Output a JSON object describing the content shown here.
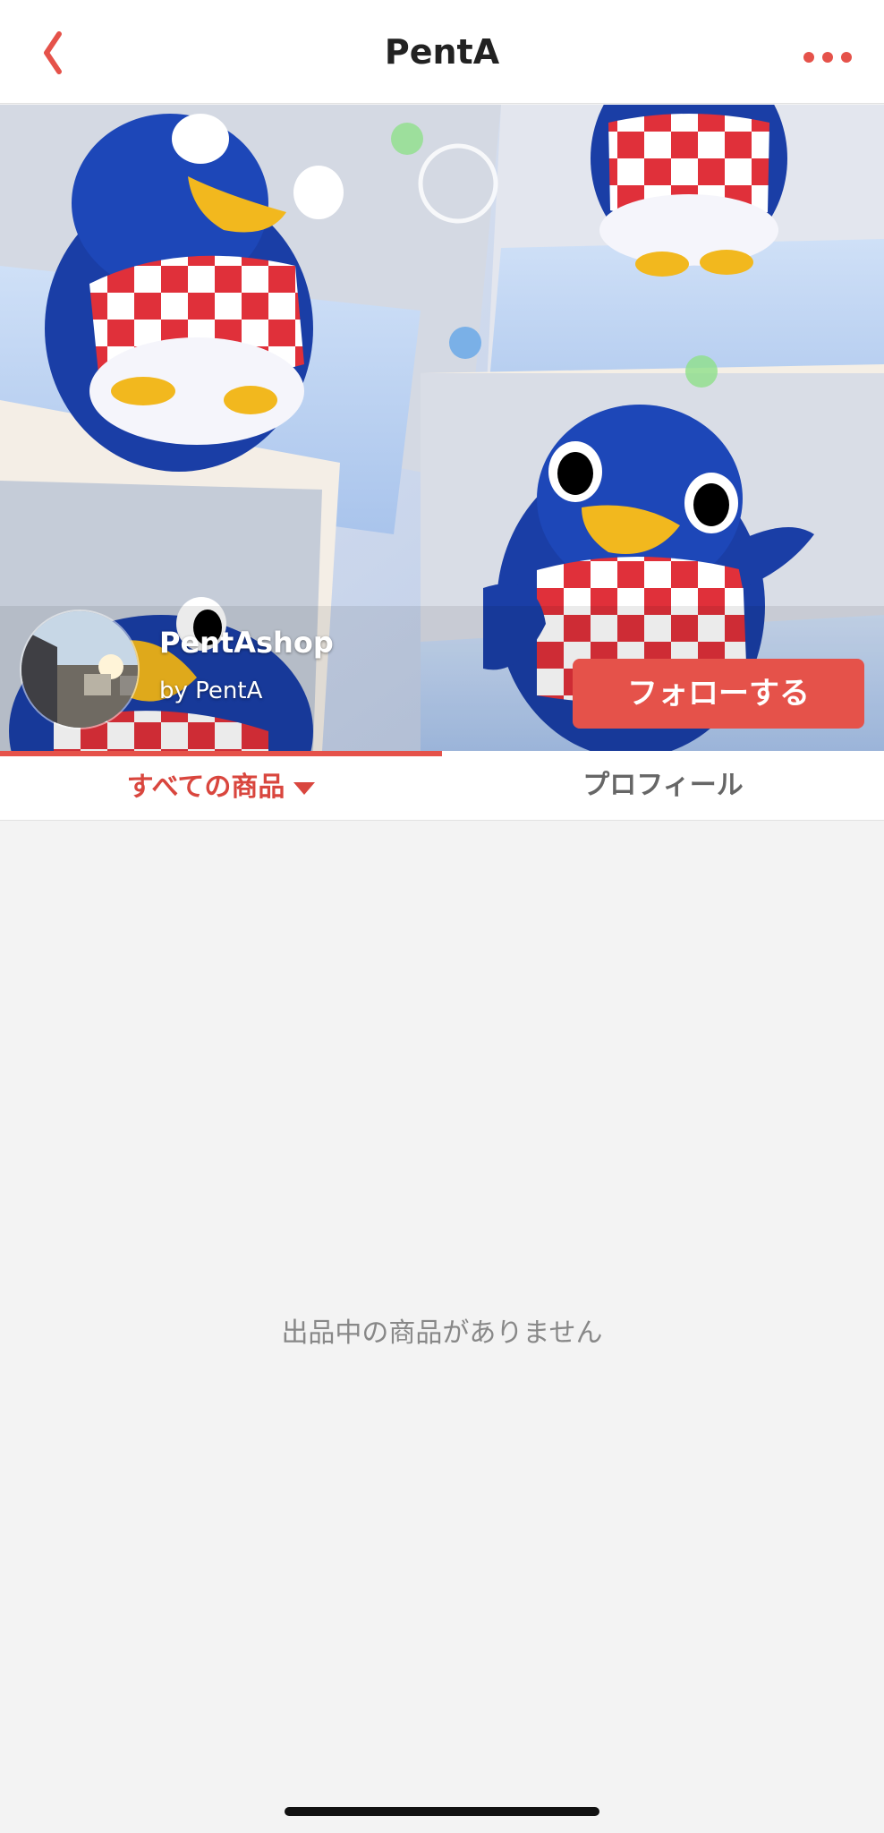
{
  "nav": {
    "title": "PentA",
    "back_icon": "chevron-left-icon",
    "more_icon": "ellipsis-icon",
    "accent_color": "#e5524a"
  },
  "shop": {
    "name": "PentAshop",
    "owner": "by PentA",
    "follow_label": "フォローする",
    "cover_image": "penguin-collage",
    "avatar_image": "street-photo"
  },
  "tabs": [
    {
      "label": "すべての商品",
      "active": true,
      "icon": "caret-down-icon"
    },
    {
      "label": "プロフィール",
      "active": false
    }
  ],
  "content": {
    "empty_message": "出品中の商品がありません"
  }
}
